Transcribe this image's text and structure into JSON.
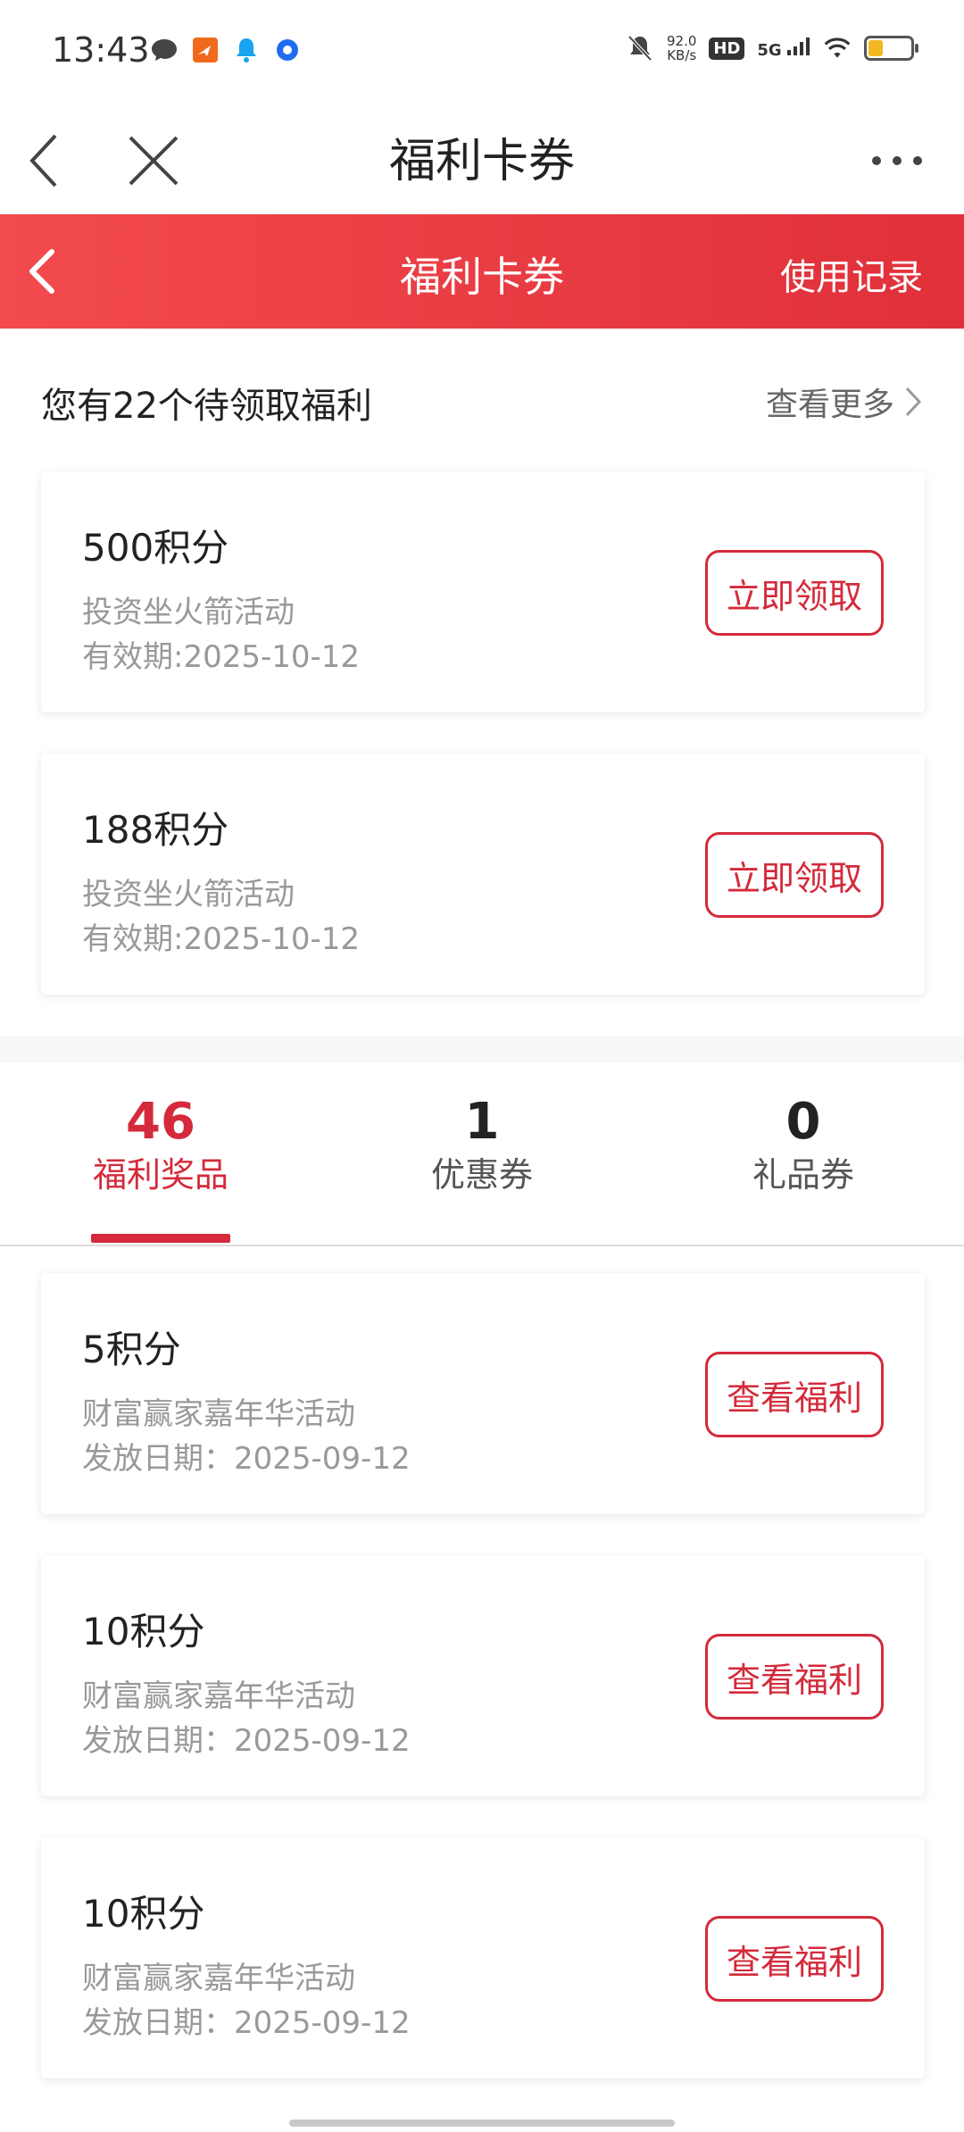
{
  "status_bar": {
    "time": "13:43",
    "net_speed_value": "92.0",
    "net_speed_unit": "KB/s",
    "hd_label": "HD",
    "signal_label": "5G"
  },
  "nav": {
    "title": "福利卡券"
  },
  "header": {
    "title": "福利卡券",
    "record_label": "使用记录"
  },
  "pending": {
    "title": "您有22个待领取福利",
    "more_label": "查看更多",
    "items": [
      {
        "title": "500积分",
        "subtitle": "投资坐火箭活动",
        "date": "有效期:2025-10-12",
        "button": "立即领取"
      },
      {
        "title": "188积分",
        "subtitle": "投资坐火箭活动",
        "date": "有效期:2025-10-12",
        "button": "立即领取"
      }
    ]
  },
  "tabs": [
    {
      "count": "46",
      "label": "福利奖品"
    },
    {
      "count": "1",
      "label": "优惠券"
    },
    {
      "count": "0",
      "label": "礼品券"
    }
  ],
  "list": {
    "items": [
      {
        "title": "5积分",
        "subtitle": "财富赢家嘉年华活动",
        "date": "发放日期：2025-09-12",
        "button": "查看福利"
      },
      {
        "title": "10积分",
        "subtitle": "财富赢家嘉年华活动",
        "date": "发放日期：2025-09-12",
        "button": "查看福利"
      },
      {
        "title": "10积分",
        "subtitle": "财富赢家嘉年华活动",
        "date": "发放日期：2025-09-12",
        "button": "查看福利"
      }
    ]
  },
  "colors": {
    "brand_red": "#d42a3b",
    "header_gradient_start": "#f24a4e",
    "header_gradient_end": "#e0303a"
  }
}
